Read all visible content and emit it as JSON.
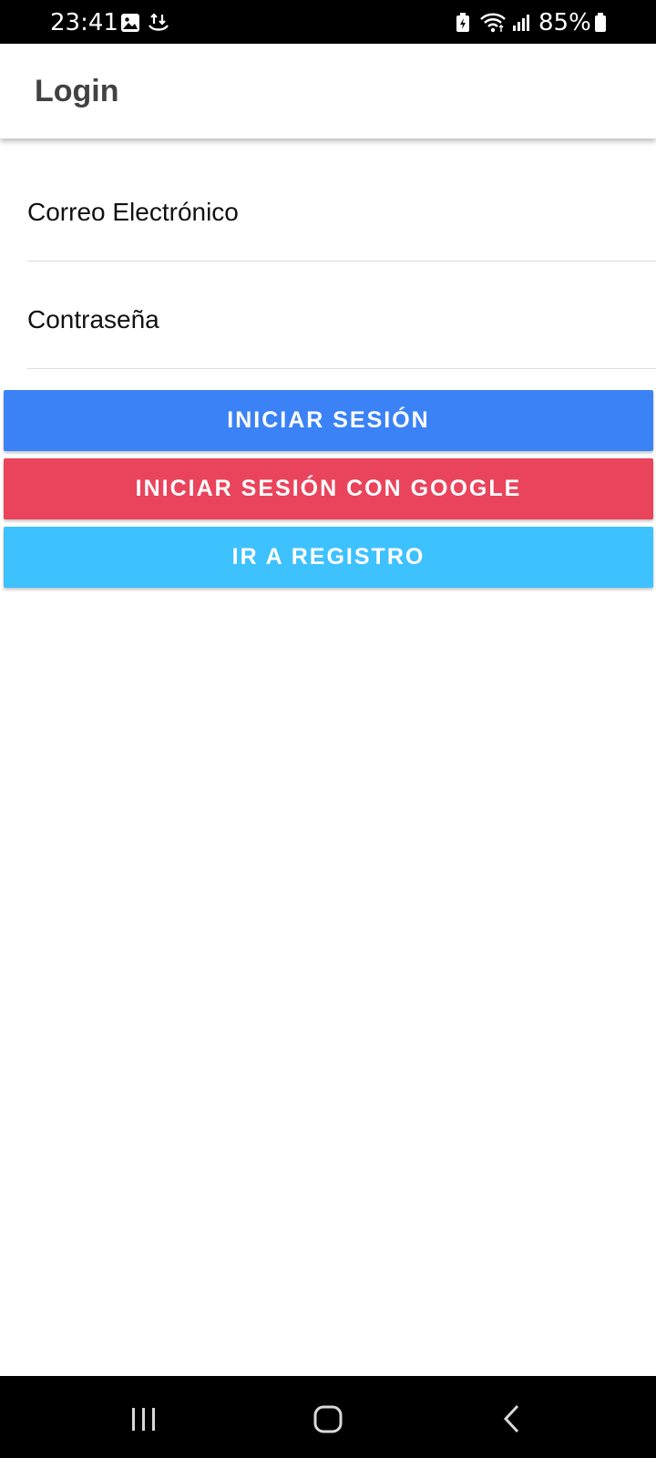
{
  "status_bar": {
    "time": "23:41",
    "battery": "85%",
    "icons": [
      "image-icon",
      "data-transfer-icon",
      "battery-saver-icon",
      "wifi-icon",
      "signal-icon",
      "battery-icon"
    ]
  },
  "app_bar": {
    "title": "Login"
  },
  "form": {
    "email_label": "Correo Electrónico",
    "password_label": "Contraseña"
  },
  "buttons": {
    "login": "INICIAR SESIÓN",
    "login_google": "INICIAR SESIÓN CON GOOGLE",
    "register": "IR A REGISTRO"
  },
  "colors": {
    "login_button": "#3b82f6",
    "google_button": "#e9445c",
    "register_button": "#3ec1ff"
  },
  "nav_bar": {
    "icons": [
      "recent-apps-icon",
      "home-icon",
      "back-icon"
    ]
  }
}
